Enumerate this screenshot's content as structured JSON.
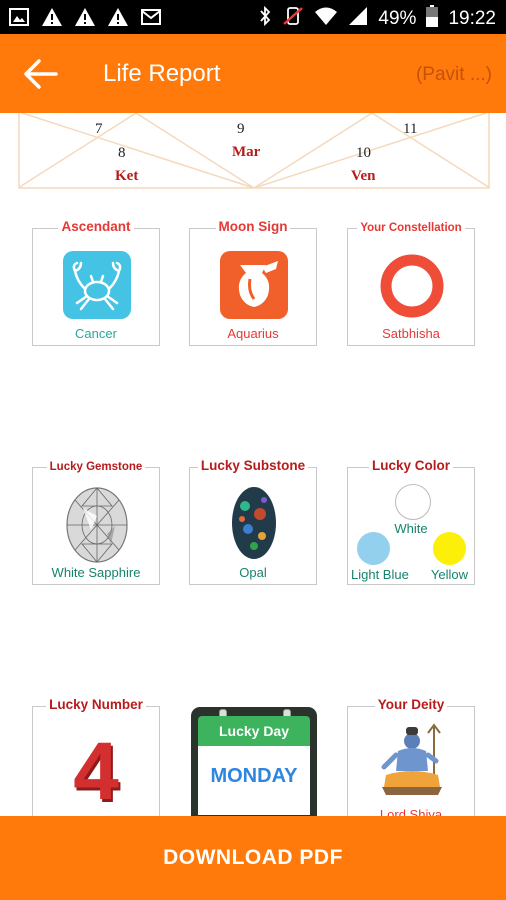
{
  "status_bar": {
    "battery": "49%",
    "time": "19:22"
  },
  "app_bar": {
    "title": "Life Report",
    "user": "(Pavit ...)"
  },
  "chart": {
    "numbers": [
      "7",
      "9",
      "11",
      "8",
      "10"
    ],
    "planets": [
      "Mar",
      "Ket",
      "Ven"
    ]
  },
  "cards": {
    "ascendant": {
      "title": "Ascendant",
      "value": "Cancer"
    },
    "moon_sign": {
      "title": "Moon Sign",
      "value": "Aquarius"
    },
    "constellation": {
      "title": "Your Constellation",
      "value": "Satbhisha"
    },
    "gemstone": {
      "title": "Lucky Gemstone",
      "value": "White Sapphire"
    },
    "substone": {
      "title": "Lucky Substone",
      "value": "Opal"
    },
    "color": {
      "title": "Lucky Color",
      "values": [
        "White",
        "Light Blue",
        "Yellow"
      ],
      "hex": [
        "#ffffff",
        "#92d0ee",
        "#fcef08"
      ]
    },
    "number": {
      "title": "Lucky Number",
      "value": "4"
    },
    "day": {
      "title": "Lucky Day",
      "value": "MONDAY"
    },
    "deity": {
      "title": "Your Deity",
      "value": "Lord Shiva"
    }
  },
  "download": {
    "label": "DOWNLOAD PDF"
  },
  "colors": {
    "primary": "#FF7A0B",
    "title_red": "#e53935",
    "value_teal": "#2aa79b",
    "chart_line": "#f5d9bd"
  }
}
